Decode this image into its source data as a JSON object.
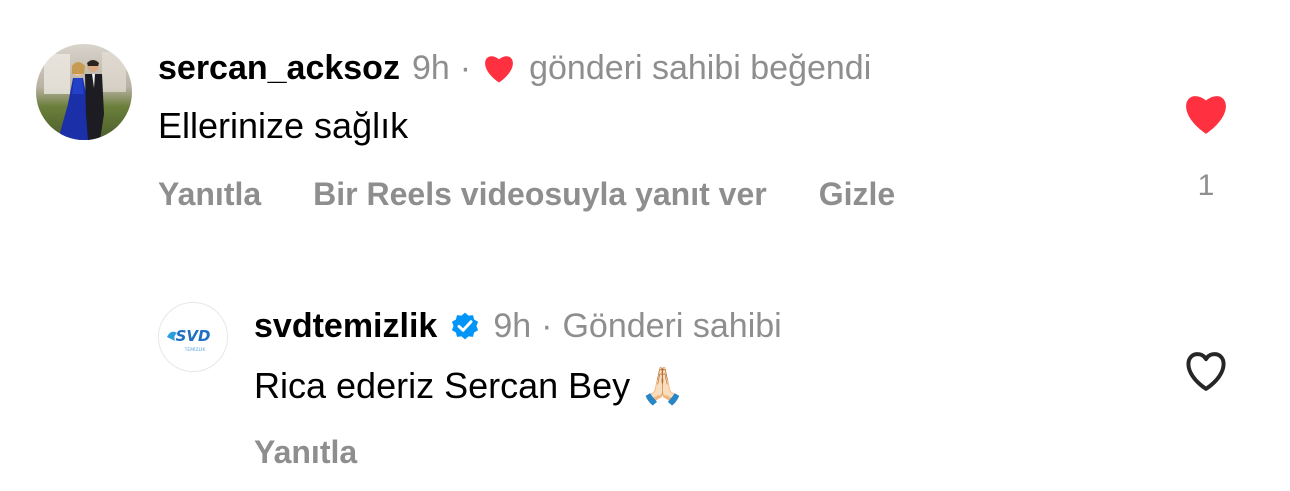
{
  "comments": [
    {
      "username": "sercan_acksoz",
      "time": "9h",
      "separator": "·",
      "badge_text": "gönderi sahibi beğendi",
      "text": "Ellerinize sağlık",
      "actions": [
        "Yanıtla",
        "Bir Reels videosuyla yanıt ver",
        "Gizle"
      ],
      "liked": true,
      "like_count": "1",
      "like_color": "#ff3040"
    },
    {
      "username": "svdtemizlik",
      "verified": true,
      "time": "9h",
      "separator": "·",
      "badge_text": "Gönderi sahibi",
      "text": "Rica ederiz Sercan Bey 🙏🏻",
      "actions": [
        "Yanıtla"
      ],
      "liked": false,
      "avatar_logo_text": "SVD",
      "avatar_logo_subtext": "TEMİZLİK",
      "verified_color": "#0095f6"
    }
  ]
}
